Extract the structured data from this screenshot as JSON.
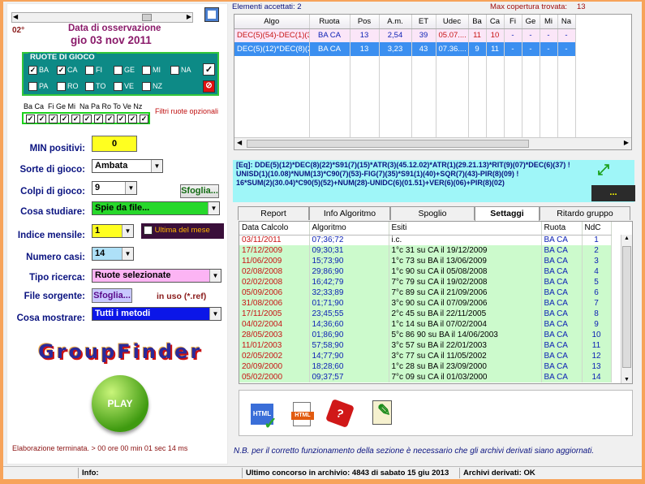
{
  "header": {
    "elementi_accettati": "Elementi accettati: 2",
    "max_copertura": "Max copertura trovata:",
    "max_copertura_val": "13"
  },
  "left": {
    "degree": "02°",
    "data_label": "Data di osservazione",
    "data_value": "gio 03 nov 2011",
    "ruote_title": "RUOTE DI GIOCO",
    "ruote_row1": [
      {
        "name": "BA",
        "checked": true
      },
      {
        "name": "CA",
        "checked": true
      },
      {
        "name": "FI",
        "checked": false
      },
      {
        "name": "GE",
        "checked": false
      },
      {
        "name": "MI",
        "checked": false
      },
      {
        "name": "NA",
        "checked": false
      }
    ],
    "ruote_row2": [
      {
        "name": "PA",
        "checked": false
      },
      {
        "name": "RO",
        "checked": false
      },
      {
        "name": "TO",
        "checked": false
      },
      {
        "name": "VE",
        "checked": false
      },
      {
        "name": "NZ",
        "checked": false
      }
    ],
    "filtri_header": "Ba Ca  Fi Ge Mi  Na Pa Ro To Ve Nz",
    "filtri_label": "Filtri ruote opzionali",
    "min_positivi_label": "MIN positivi:",
    "min_positivi_value": "0",
    "sorte_label": "Sorte di gioco:",
    "sorte_value": "Ambata",
    "colpi_label": "Colpi di gioco:",
    "colpi_value": "9",
    "sfoglia1": "Sfoglia...",
    "cosa_studiare_label": "Cosa studiare:",
    "cosa_studiare_value": "Spie da file...",
    "indice_label": "Indice mensile:",
    "indice_value": "1",
    "ultima_mese": "Ultima del mese",
    "numero_casi_label": "Numero casi:",
    "numero_casi_value": "14",
    "tipo_ricerca_label": "Tipo ricerca:",
    "tipo_ricerca_value": "Ruote selezionate",
    "file_sorgente_label": "File sorgente:",
    "sfoglia2": "Sfoglia...",
    "in_uso": "in uso (*.ref)",
    "cosa_mostrare_label": "Cosa mostrare:",
    "cosa_mostrare_value": "Tutti i metodi",
    "logo": "GroupFinder",
    "play": "PLAY",
    "elaborazione": "Elaborazione terminata. > 00 ore 00 min 01 sec 14 ms"
  },
  "grid": {
    "columns": [
      "Algo",
      "Ruota",
      "Pos",
      "A.m.",
      "ET",
      "Udec",
      "Ba",
      "Ca",
      "Fi",
      "Ge",
      "Mi",
      "Na"
    ],
    "rows": [
      [
        "DEC(5)(54)-DEC(1)(3...",
        "BA CA",
        "13",
        "2,54",
        "39",
        "05.07....",
        "11",
        "10",
        "-",
        "-",
        "-",
        "-"
      ],
      [
        "DEC(5)(12)*DEC(8)(2...",
        "BA CA",
        "13",
        "3,23",
        "43",
        "07.36....",
        "9",
        "11",
        "-",
        "-",
        "-",
        "-"
      ]
    ]
  },
  "formula": {
    "line1": "[Eq]: DDE(5)(12)*DEC(8)(22)*S91(7)(15)*ATR(3)(45.12.02)*ATR(1)(29.21.13)*RIT(9)(07)*DEC(6)(37) !",
    "line2": "UNISD(1)(10.08)*NUM(13)*C90(7)(53)-FIG(7)(35)*S91(1)(40)+SQR(7)(43)-PIR(8)(09) !",
    "line3": "16*SUM(2)(30.04)*C90(5)(52)+NUM(28)-UNIDC(6)(01.51)+VER(6)(06)+PIR(8)(02)"
  },
  "dots_button": "...",
  "tabs": [
    "Report",
    "Info Algoritmo",
    "Spoglio",
    "Settaggi",
    "Ritardo gruppo"
  ],
  "results": {
    "columns": [
      "Data Calcolo",
      "Algoritmo",
      "Esiti",
      "Ruota",
      "NdC"
    ],
    "rows": [
      [
        "03/11/2011",
        "07;36;72",
        "i.c.",
        "BA CA",
        "1"
      ],
      [
        "17/12/2009",
        "09;30;31",
        "1°c 31 su CA il 19/12/2009",
        "BA CA",
        "2"
      ],
      [
        "11/06/2009",
        "15;73;90",
        "1°c 73 su BA il 13/06/2009",
        "BA CA",
        "3"
      ],
      [
        "02/08/2008",
        "29;86;90",
        "1°c 90 su CA il 05/08/2008",
        "BA CA",
        "4"
      ],
      [
        "02/02/2008",
        "16;42;79",
        "7°c 79 su CA il 19/02/2008",
        "BA CA",
        "5"
      ],
      [
        "05/09/2006",
        "32;33;89",
        "7°c 89 su CA il 21/09/2006",
        "BA CA",
        "6"
      ],
      [
        "31/08/2006",
        "01;71;90",
        "3°c 90 su CA il 07/09/2006",
        "BA CA",
        "7"
      ],
      [
        "17/11/2005",
        "23;45;55",
        "2°c 45 su BA il 22/11/2005",
        "BA CA",
        "8"
      ],
      [
        "04/02/2004",
        "14;36;60",
        "1°c 14 su BA il 07/02/2004",
        "BA CA",
        "9"
      ],
      [
        "28/05/2003",
        "01;86;90",
        "5°c 86 90 su BA il 14/06/2003",
        "BA CA",
        "10"
      ],
      [
        "11/01/2003",
        "57;58;90",
        "3°c 57 su BA il 22/01/2003",
        "BA CA",
        "11"
      ],
      [
        "02/05/2002",
        "14;77;90",
        "3°c 77 su CA il 11/05/2002",
        "BA CA",
        "12"
      ],
      [
        "20/09/2000",
        "18;28;60",
        "1°c 28 su BA il 23/09/2000",
        "BA CA",
        "13"
      ],
      [
        "05/02/2000",
        "09;37;57",
        "7°c 09 su CA il 01/03/2000",
        "BA CA",
        "14"
      ]
    ]
  },
  "icons": [
    "html-check-icon",
    "html-file-icon",
    "dice-icon",
    "edit-document-icon"
  ],
  "note": "N.B. per il corretto funzionamento della sezione è necessario che gli archivi derivati siano aggiornati.",
  "status": {
    "info": "Info:",
    "ultimo": "Ultimo concorso in archivio: 4843 di sabato 15 giu 2013",
    "derivati": "Archivi derivati: OK"
  },
  "colors": {
    "accent": "#f7a35a",
    "ruote_bg": "#0d8a86",
    "formula_bg": "#9ff6f8",
    "result_row": "#ccfacc",
    "selected_row": "#3b8ff0"
  }
}
